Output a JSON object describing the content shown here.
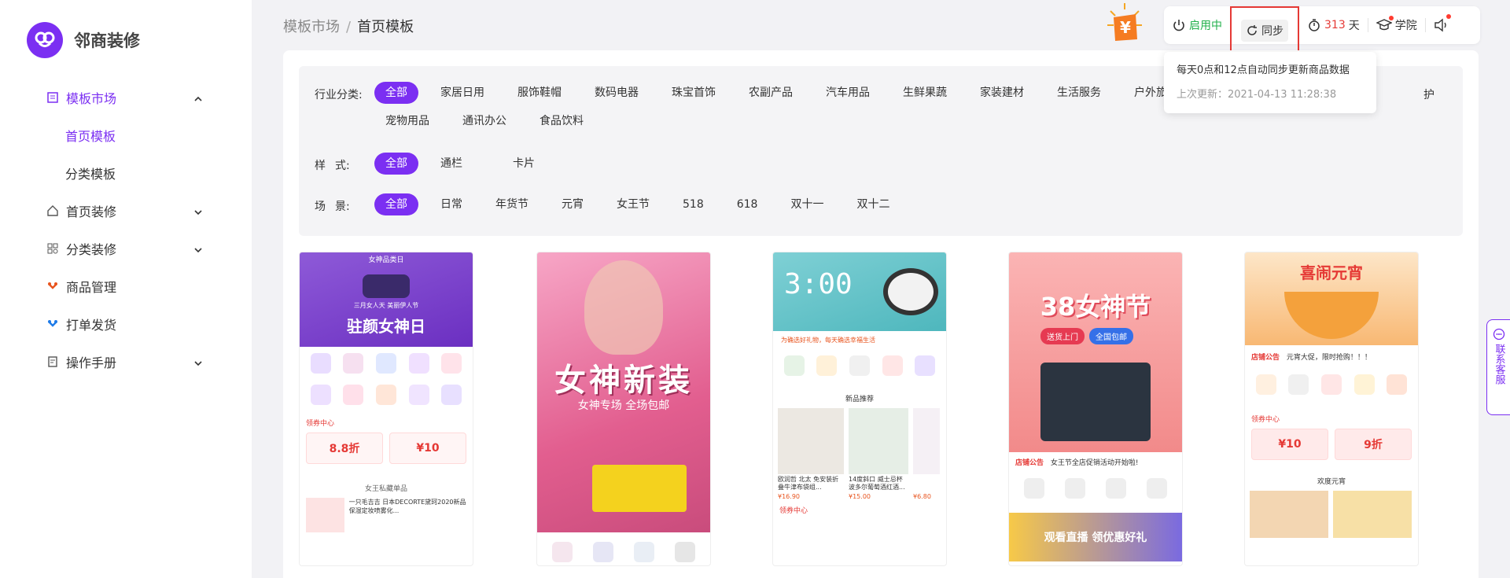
{
  "sidebar": {
    "logo_text": "邻商装修",
    "items": [
      {
        "label": "模板市场",
        "icon": "template-icon",
        "expanded": true
      },
      {
        "label": "首页模板",
        "sub": true,
        "active": true
      },
      {
        "label": "分类模板",
        "sub": true
      },
      {
        "label": "首页装修",
        "icon": "home-icon"
      },
      {
        "label": "分类装修",
        "icon": "grid-icon"
      },
      {
        "label": "商品管理",
        "icon": "goods-icon"
      },
      {
        "label": "打单发货",
        "icon": "ship-icon"
      },
      {
        "label": "操作手册",
        "icon": "manual-icon"
      }
    ]
  },
  "breadcrumb": {
    "parent": "模板市场",
    "separator": "/",
    "current": "首页模板"
  },
  "topbar": {
    "status": "启用中",
    "sync": "同步",
    "days_num": "313",
    "days_unit": "天",
    "academy": "学院"
  },
  "tooltip": {
    "line1": "每天0点和12点自动同步更新商品数据",
    "line2_label": "上次更新：",
    "line2_value": "2021-04-13 11:28:38"
  },
  "filters": {
    "industry_label": "行业分类:",
    "industry": [
      "全部",
      "家居日用",
      "服饰鞋帽",
      "数码电器",
      "珠宝首饰",
      "农副产品",
      "汽车用品",
      "生鲜果蔬",
      "家装建材",
      "生活服务",
      "户外旅游"
    ],
    "industry_row2": [
      "宠物用品",
      "通讯办公",
      "食品饮料"
    ],
    "industry_overflow": "护",
    "style_label_a": "样",
    "style_label_b": "式:",
    "style": [
      "全部",
      "通栏",
      "卡片"
    ],
    "scene_label_a": "场",
    "scene_label_b": "景:",
    "scene": [
      "全部",
      "日常",
      "年货节",
      "元宵",
      "女王节",
      "518",
      "618",
      "双十一",
      "双十二"
    ]
  },
  "cards": [
    {
      "title": "驻颜女神日",
      "tag": "女神品类日",
      "sub": "三月女人天 美丽伊人节",
      "coupon_head": "领券中心",
      "coupon1": "8.8折",
      "coupon2": "¥10",
      "section": "女王私藏单品",
      "item_text": "一只毛吉吉 日本DECORTE黛珂2020新品 保湿定妆喷雾化..."
    },
    {
      "title": "女神新装",
      "sub": "女神专场 全场包邮"
    },
    {
      "title": "3:00",
      "bar_text": "为确选好礼物，每天确选幸福生活",
      "section": "新品推荐",
      "coupon_head": "领券中心",
      "item1": "欧润哲 北太 免安装折叠牛津布袋组...",
      "price1": "¥16.90",
      "item2": "14度斜口 威士忌杯 波多尔葡萄酒红酒...",
      "price2": "¥15.00",
      "price3": "¥6.80"
    },
    {
      "title": "38女神节",
      "badge1": "送货上门",
      "badge2": "全国包邮",
      "notice": "店铺公告",
      "notice_text": "女王节全店促销活动开始啦!",
      "live": "观看直播 领优惠好礼"
    },
    {
      "title": "喜闹元宵",
      "notice": "店铺公告",
      "notice_text": "元宵大促，限时抢购！！！",
      "coupon_head": "领券中心",
      "coupon1": "¥10",
      "coupon2": "9折",
      "section": "欢度元宵"
    }
  ],
  "service": "联系客服",
  "colors": {
    "accent": "#7b2ff2",
    "red": "#e53935",
    "green": "#22b14c"
  }
}
